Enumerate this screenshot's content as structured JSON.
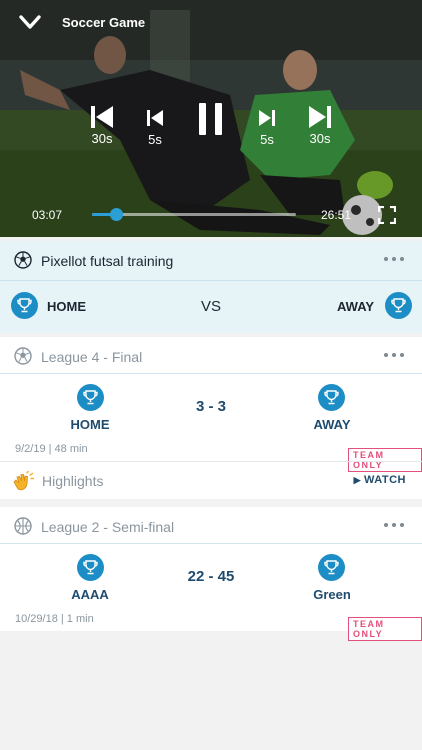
{
  "player": {
    "title": "Soccer Game",
    "controls": {
      "skip_back_long": "30s",
      "skip_back_short": "5s",
      "skip_fwd_short": "5s",
      "skip_fwd_long": "30s"
    },
    "current_time": "03:07",
    "duration": "26:51",
    "progress": 0.116
  },
  "live_match": {
    "name": "Pixellot futsal training",
    "home": "HOME",
    "vs": "VS",
    "away": "AWAY"
  },
  "games": [
    {
      "name": "League 4 - Final",
      "home": "HOME",
      "score": "3 - 3",
      "away": "AWAY",
      "meta": "9/2/19 | 48 min",
      "badge": "TEAM ONLY",
      "highlights_label": "Highlights",
      "watch_label": "WATCH"
    },
    {
      "name": "League 2 - Semi-final",
      "home": "AAAA",
      "score": "22 - 45",
      "away": "Green",
      "meta": "10/29/18 | 1 min",
      "badge": "TEAM ONLY"
    }
  ],
  "colors": {
    "accent": "#1c8ec5",
    "progress": "#2a9fd6",
    "team_only": "#e2507b",
    "live_bg": "#e6f4f8",
    "score_text": "#1e4b6e"
  }
}
